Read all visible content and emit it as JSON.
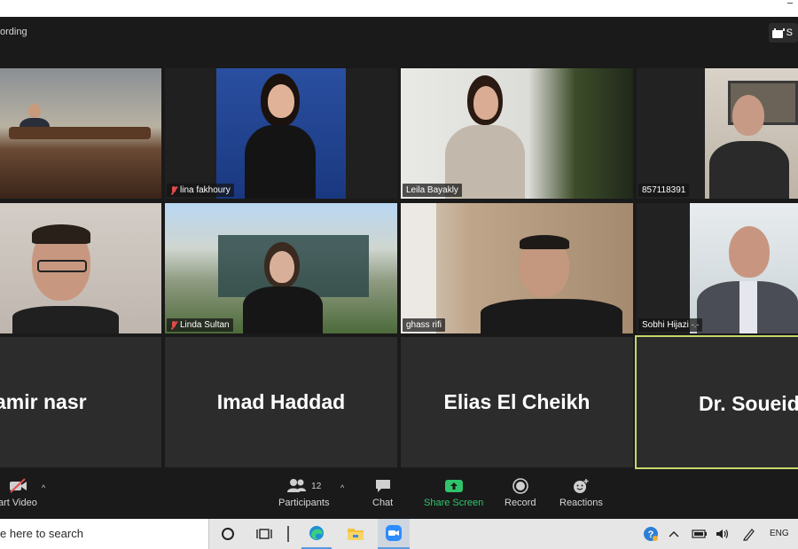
{
  "meeting": {
    "recording_label": "ording",
    "view_button_label": "S"
  },
  "participants": [
    {
      "name": "",
      "muted": false
    },
    {
      "name": "lina fakhoury",
      "muted": true
    },
    {
      "name": "Leila Bayakly",
      "muted": false
    },
    {
      "name": "857118391",
      "muted": false
    },
    {
      "name": "",
      "muted": false
    },
    {
      "name": "Linda Sultan",
      "muted": true
    },
    {
      "name": "ghass rifi",
      "muted": false
    },
    {
      "name": "Sobhi Hijazi",
      "muted": false
    },
    {
      "name": "amir nasr",
      "muted": false
    },
    {
      "name": "Imad Haddad",
      "muted": false
    },
    {
      "name": "Elias El Cheikh",
      "muted": false
    },
    {
      "name": "Dr. Soueid",
      "muted": false
    }
  ],
  "toolbar": {
    "start_video_label": "art Video",
    "participants_label": "Participants",
    "participants_count": "12",
    "chat_label": "Chat",
    "share_screen_label": "Share Screen",
    "record_label": "Record",
    "reactions_label": "Reactions"
  },
  "taskbar": {
    "search_placeholder": "e here to search",
    "language": "ENG"
  },
  "colors": {
    "share_screen_green": "#2fc46c",
    "active_speaker_border": "#c4d86a",
    "mute_red": "#e14b4b"
  }
}
